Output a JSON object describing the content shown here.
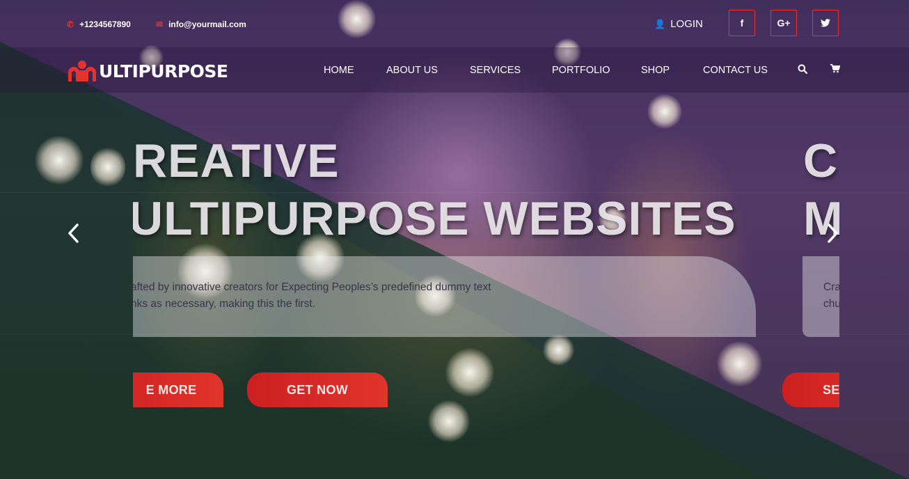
{
  "topbar": {
    "phone": "+1234567890",
    "email": "info@yourmail.com",
    "login": "LOGIN",
    "social": [
      {
        "icon": "facebook-icon",
        "glyph": "f"
      },
      {
        "icon": "google-plus-icon",
        "glyph": "G+"
      },
      {
        "icon": "twitter-icon",
        "glyph": "🐦"
      }
    ]
  },
  "brand": {
    "logo_text": "ULTIPURPOSE",
    "accent_color": "#e5322d"
  },
  "nav": {
    "items": [
      "HOME",
      "ABOUT US",
      "SERVICES",
      "PORTFOLIO",
      "SHOP",
      "CONTACT US"
    ],
    "search_icon": "search-icon",
    "cart_icon": "cart-icon"
  },
  "slider": {
    "slide1": {
      "line1": "REATIVE",
      "line2": "ULTIPURPOSE WEBSITES",
      "caption_line1": "afted by innovative creators for Expecting Peoples’s predefined dummy text",
      "caption_line2": "nks as necessary, making this the first.",
      "button_more": "E MORE",
      "button_get": "GET NOW"
    },
    "slide2": {
      "line1": "C",
      "line2": "M",
      "caption_line1": "Cra",
      "caption_line2": "chu",
      "button": "SE"
    },
    "prev_icon": "chevron-left-icon",
    "next_icon": "chevron-right-icon"
  }
}
